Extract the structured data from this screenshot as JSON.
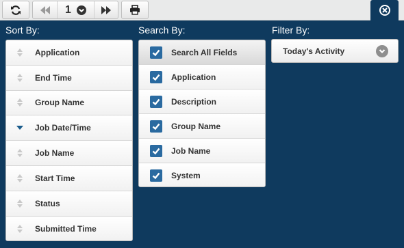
{
  "toolbar": {
    "page_number": "1"
  },
  "colors": {
    "background": "#0f3a5e",
    "checkbox": "#2a6aa0",
    "active_sort": "#1a5c8c"
  },
  "sort": {
    "heading": "Sort By:",
    "items": [
      {
        "label": "Application",
        "active": false
      },
      {
        "label": "End Time",
        "active": false
      },
      {
        "label": "Group Name",
        "active": false
      },
      {
        "label": "Job Date/Time",
        "active": true
      },
      {
        "label": "Job Name",
        "active": false
      },
      {
        "label": "Start Time",
        "active": false
      },
      {
        "label": "Status",
        "active": false
      },
      {
        "label": "Submitted Time",
        "active": false
      }
    ]
  },
  "search": {
    "heading": "Search By:",
    "items": [
      {
        "label": "Search All Fields",
        "checked": true
      },
      {
        "label": "Application",
        "checked": true
      },
      {
        "label": "Description",
        "checked": true
      },
      {
        "label": "Group Name",
        "checked": true
      },
      {
        "label": "Job Name",
        "checked": true
      },
      {
        "label": "System",
        "checked": true
      }
    ]
  },
  "filter": {
    "heading": "Filter By:",
    "selected": "Today's Activity"
  }
}
